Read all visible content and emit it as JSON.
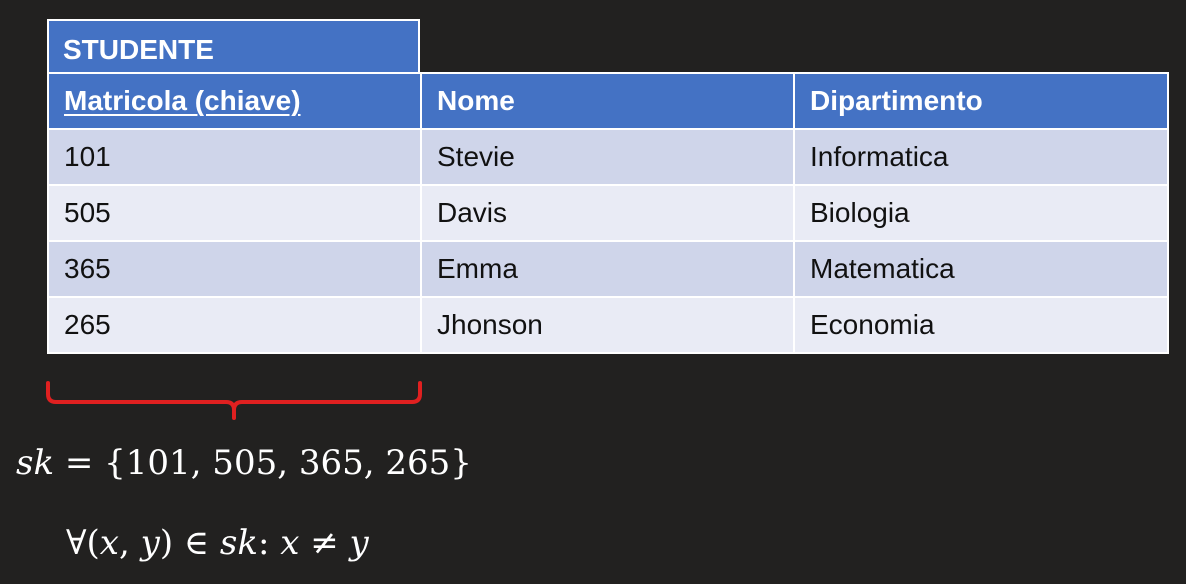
{
  "table": {
    "title": "STUDENTE",
    "headers": [
      "Matricola (chiave)",
      "Nome",
      "Dipartimento"
    ],
    "rows": [
      [
        "101",
        "Stevie",
        "Informatica"
      ],
      [
        "505",
        "Davis",
        "Biologia"
      ],
      [
        "365",
        "Emma",
        "Matematica"
      ],
      [
        "265",
        "Jhonson",
        "Economia"
      ]
    ]
  },
  "colors": {
    "background": "#222120",
    "header": "#4472c4",
    "row_odd": "#cfd5ea",
    "row_even": "#e9ebf5",
    "brace": "#e02020"
  },
  "formulas": {
    "f1_var": "sk",
    "f1_rest": " = {101, 505, 365, 265}",
    "f2_forall": "∀(",
    "f2_x": "x",
    "f2_comma": ", ",
    "f2_y": "y",
    "f2_in": ") ∈ ",
    "f2_sk": "sk",
    "f2_colon": ": ",
    "f2_x2": "x",
    "f2_neq": " ≠ ",
    "f2_y2": "y"
  }
}
